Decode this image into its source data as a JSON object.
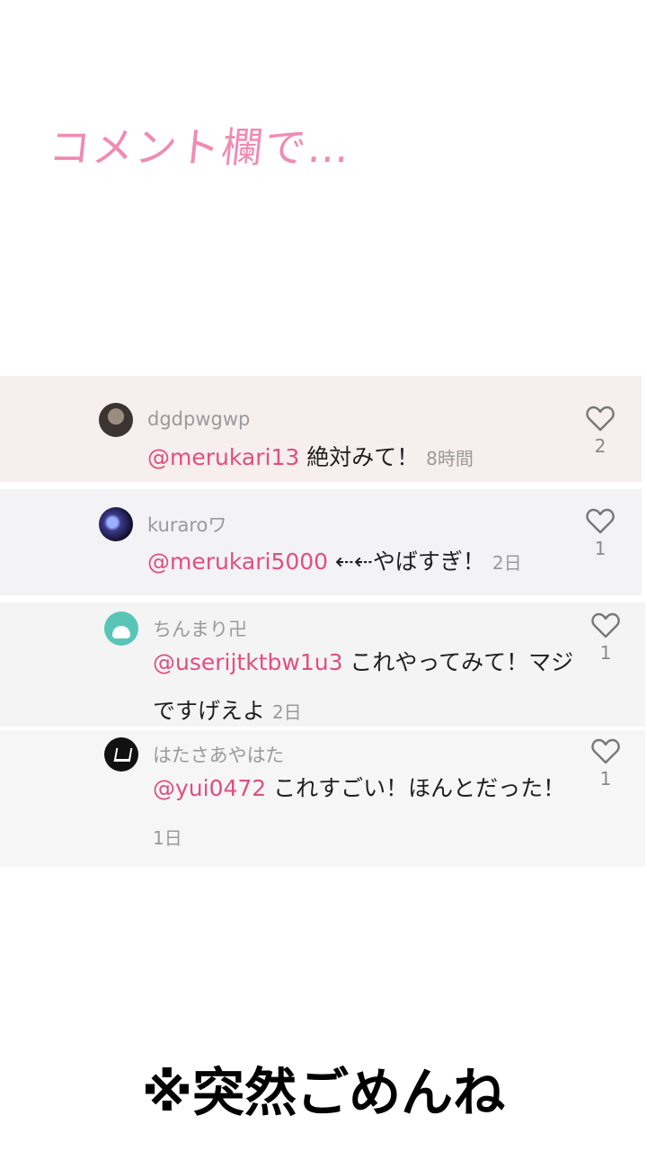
{
  "header": {
    "title": "コメント欄で…"
  },
  "comments": [
    {
      "username": "dgdpwgwp",
      "mention": "@merukari13",
      "text": " 絶対みて！ ",
      "time": "8時間",
      "likes": "2"
    },
    {
      "username": "kuraroワ",
      "mention": "@merukari5000",
      "text": " ⇠⇠やばすぎ！ ",
      "time": "2日",
      "likes": "1"
    },
    {
      "username": "ちんまり卍",
      "mention": "@userijtktbw1u3",
      "text": " これやってみて！マジですげえよ ",
      "time": "2日",
      "likes": "1"
    },
    {
      "username": "はたさあやはた",
      "mention": "@yui0472",
      "text": " これすごい！ほんとだった！ ",
      "time": "1日",
      "likes": "1"
    }
  ],
  "footer": {
    "text": "※突然ごめんね"
  },
  "colors": {
    "mention": "#e14f7e",
    "title": "#f08bb4"
  },
  "icons": {
    "like": "heart-outline-icon"
  }
}
